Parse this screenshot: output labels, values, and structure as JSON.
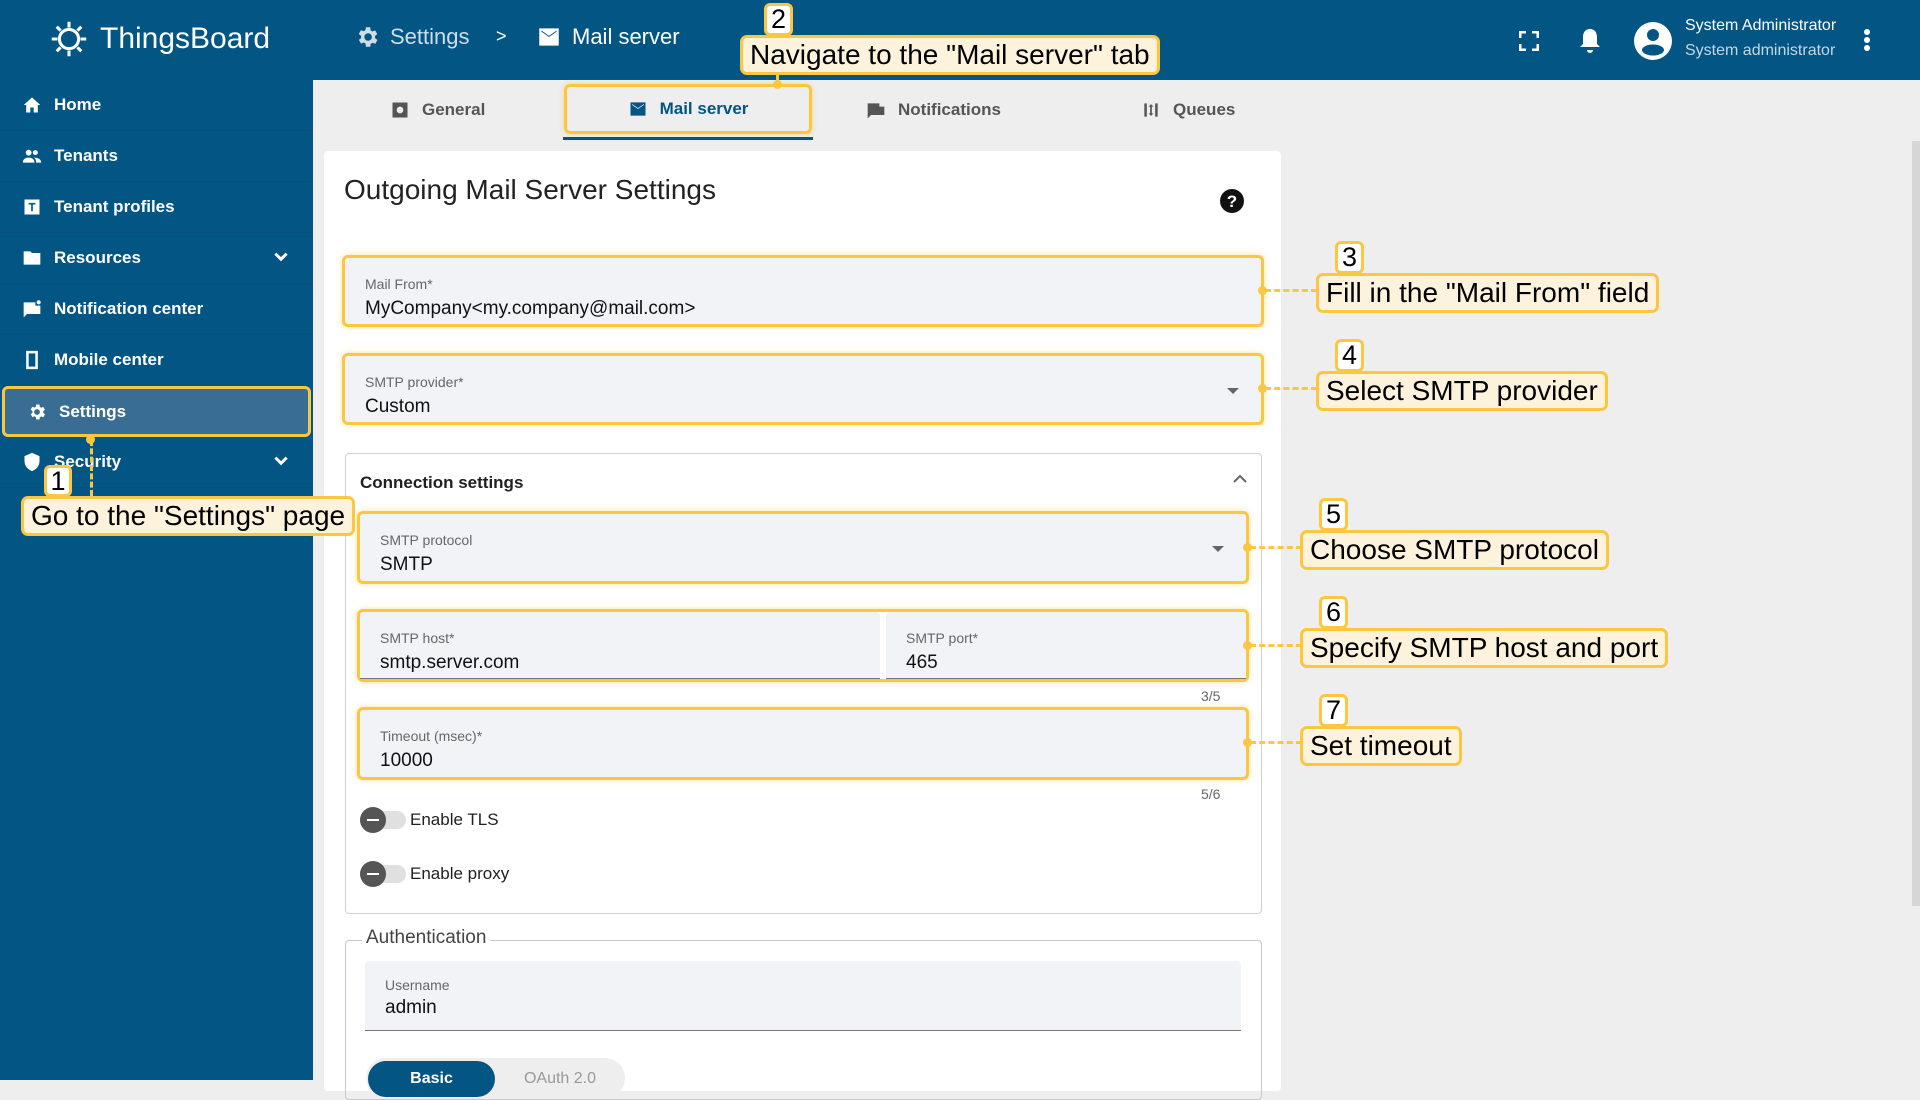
{
  "header": {
    "brand": "ThingsBoard",
    "breadcrumb": [
      "Settings",
      "Mail server"
    ],
    "breadcrumb_sep": ">",
    "user_name": "System Administrator",
    "user_role": "System administrator"
  },
  "sidebar": {
    "items": [
      {
        "label": "Home"
      },
      {
        "label": "Tenants"
      },
      {
        "label": "Tenant profiles"
      },
      {
        "label": "Resources"
      },
      {
        "label": "Notification center"
      },
      {
        "label": "Mobile center"
      },
      {
        "label": "Settings"
      },
      {
        "label": "Security"
      }
    ]
  },
  "tabs": [
    {
      "label": "General"
    },
    {
      "label": "Mail server"
    },
    {
      "label": "Notifications"
    },
    {
      "label": "Queues"
    }
  ],
  "form": {
    "title": "Outgoing Mail Server Settings",
    "mail_from": {
      "label": "Mail From*",
      "value": "MyCompany<my.company@mail.com>"
    },
    "smtp_provider": {
      "label": "SMTP provider*",
      "value": "Custom"
    },
    "connection": {
      "title": "Connection settings",
      "protocol": {
        "label": "SMTP protocol",
        "value": "SMTP"
      },
      "host": {
        "label": "SMTP host*",
        "value": "smtp.server.com"
      },
      "port": {
        "label": "SMTP port*",
        "value": "465",
        "counter": "3/5"
      },
      "timeout": {
        "label": "Timeout (msec)*",
        "value": "10000",
        "counter": "5/6"
      },
      "tls_label": "Enable TLS",
      "proxy_label": "Enable proxy"
    },
    "auth": {
      "title": "Authentication",
      "username": {
        "label": "Username",
        "value": "admin"
      },
      "methods": [
        "Basic",
        "OAuth 2.0"
      ]
    }
  },
  "annotations": [
    {
      "num": "1",
      "text": "Go to the \"Settings\" page"
    },
    {
      "num": "2",
      "text": "Navigate to the \"Mail server\" tab"
    },
    {
      "num": "3",
      "text": "Fill in the \"Mail From\" field"
    },
    {
      "num": "4",
      "text": "Select SMTP provider"
    },
    {
      "num": "5",
      "text": "Choose SMTP protocol"
    },
    {
      "num": "6",
      "text": "Specify SMTP host and port"
    },
    {
      "num": "7",
      "text": "Set timeout"
    }
  ],
  "colors": {
    "primary": "#035584",
    "highlight": "#fbc740",
    "callout_bg": "#fdf3dc"
  }
}
